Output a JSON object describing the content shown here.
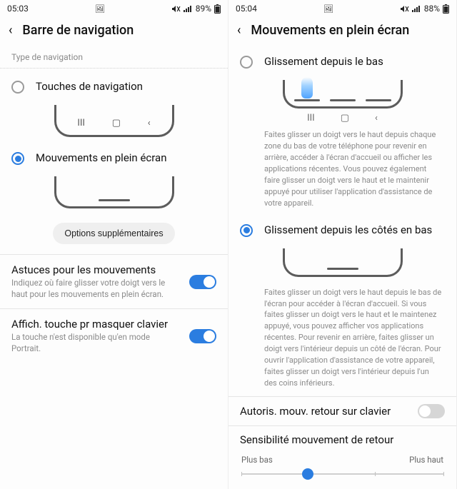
{
  "left": {
    "status": {
      "time": "05:03",
      "battery_pct": "89%"
    },
    "header": {
      "title": "Barre de navigation"
    },
    "section_label": "Type de navigation",
    "options": {
      "buttons": {
        "label": "Touches de navigation"
      },
      "gestures": {
        "label": "Mouvements en plein écran"
      }
    },
    "more_options_btn": "Options supplémentaires",
    "settings": {
      "hints": {
        "label": "Astuces pour les mouvements",
        "sub": "Indiquez où faire glisser votre doigt vers le haut pour les mouvements en plein écran.",
        "on": true
      },
      "hide_kb_button": {
        "label": "Affich. touche pr masquer clavier",
        "sub": "La touche n'est disponible qu'en mode Portrait.",
        "on": true
      }
    }
  },
  "right": {
    "status": {
      "time": "05:04",
      "battery_pct": "88%"
    },
    "header": {
      "title": "Mouvements en plein écran"
    },
    "options": {
      "swipe_bottom": {
        "label": "Glissement depuis le bas",
        "desc": "Faites glisser un doigt vers le haut depuis chaque zone du bas de votre téléphone pour revenir en arrière, accéder à l'écran d'accueil ou afficher les applications récentes. Vous pouvez également faire glisser un doigt vers le haut et le maintenir appuyé pour utiliser l'application d'assistance de votre appareil."
      },
      "swipe_sides": {
        "label": "Glissement depuis les côtés en bas",
        "desc": "Faites glisser un doigt vers le haut depuis le bas de l'écran pour accéder à l'écran d'accueil. Si vous faites glisser un doigt vers le haut et le maintenez appuyé, vous pouvez afficher vos applications récentes. Pour revenir en arrière, faites glisser un doigt vers l'intérieur depuis un côté de l'écran. Pour ouvrir l'application d'assistance de votre appareil, faites glisser un doigt vers l'intérieur depuis l'un des coins inférieurs."
      }
    },
    "settings": {
      "back_on_keyboard": {
        "label": "Autoris. mouv. retour sur clavier",
        "on": false
      }
    },
    "sensitivity": {
      "label": "Sensibilité mouvement de retour",
      "low": "Plus bas",
      "high": "Plus haut",
      "value_index": 1,
      "ticks": 4
    }
  }
}
